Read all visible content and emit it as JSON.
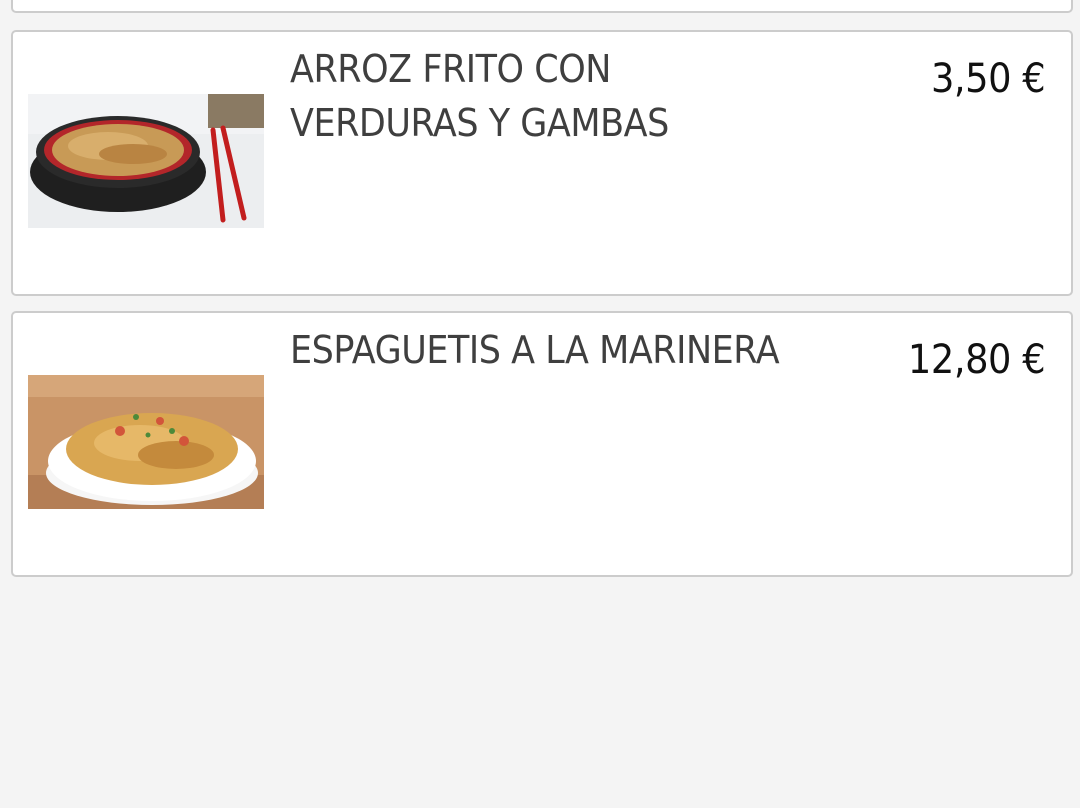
{
  "menu": {
    "items": [
      {
        "name": "ARROZ FRITO CON VERDURAS Y GAMBAS",
        "price": "3,50 €",
        "image": "fried-rice-photo"
      },
      {
        "name": "ESPAGUETIS A LA MARINERA",
        "price": "12,80 €",
        "image": "spaghetti-marinera-photo"
      }
    ]
  },
  "colors": {
    "background": "#f4f4f4",
    "card": "#ffffff",
    "card_border": "#cccccc",
    "name_text": "#3f3f3f",
    "price_text": "#111111"
  }
}
